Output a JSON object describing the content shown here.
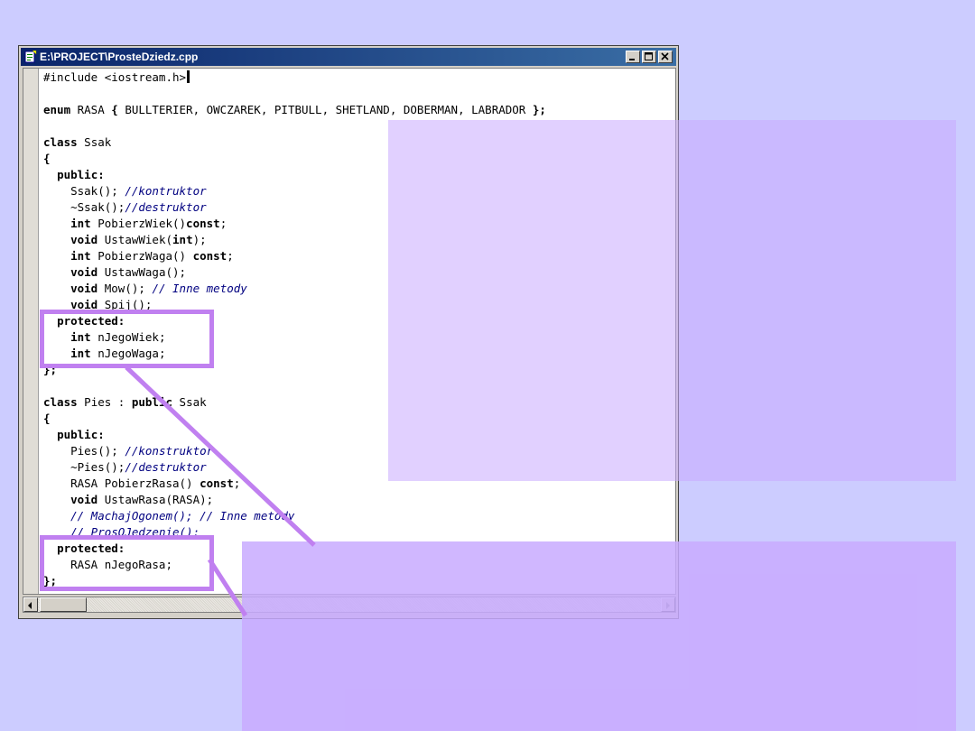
{
  "window": {
    "title": "E:\\PROJECT\\ProsteDziedz.cpp",
    "icon": "cpp-file-icon",
    "buttons": [
      "minimize-icon",
      "maximize-icon",
      "close-icon"
    ]
  },
  "code": {
    "lines": [
      [
        {
          "t": "#include <iostream.h>",
          "s": "n"
        }
      ],
      [
        {
          "t": "",
          "s": "n"
        }
      ],
      [
        {
          "t": "enum",
          "s": "kw"
        },
        {
          "t": " RASA ",
          "s": "n"
        },
        {
          "t": "{",
          "s": "kw"
        },
        {
          "t": " BULLTERIER, OWCZAREK, PITBULL, SHETLAND, DOBERMAN, LABRADOR ",
          "s": "n"
        },
        {
          "t": "};",
          "s": "kw"
        }
      ],
      [
        {
          "t": "",
          "s": "n"
        }
      ],
      [
        {
          "t": "class",
          "s": "kw"
        },
        {
          "t": " Ssak",
          "s": "n"
        }
      ],
      [
        {
          "t": "{",
          "s": "kw"
        }
      ],
      [
        {
          "t": "  ",
          "s": "n"
        },
        {
          "t": "public:",
          "s": "kw"
        }
      ],
      [
        {
          "t": "    Ssak(); ",
          "s": "n"
        },
        {
          "t": "//kontruktor",
          "s": "cm"
        }
      ],
      [
        {
          "t": "    ~Ssak();",
          "s": "n"
        },
        {
          "t": "//destruktor",
          "s": "cm"
        }
      ],
      [
        {
          "t": "    ",
          "s": "n"
        },
        {
          "t": "int",
          "s": "kw"
        },
        {
          "t": " PobierzWiek()",
          "s": "n"
        },
        {
          "t": "const",
          "s": "kw"
        },
        {
          "t": ";",
          "s": "n"
        }
      ],
      [
        {
          "t": "    ",
          "s": "n"
        },
        {
          "t": "void",
          "s": "kw"
        },
        {
          "t": " UstawWiek(",
          "s": "n"
        },
        {
          "t": "int",
          "s": "kw"
        },
        {
          "t": ");",
          "s": "n"
        }
      ],
      [
        {
          "t": "    ",
          "s": "n"
        },
        {
          "t": "int",
          "s": "kw"
        },
        {
          "t": " PobierzWaga() ",
          "s": "n"
        },
        {
          "t": "const",
          "s": "kw"
        },
        {
          "t": ";",
          "s": "n"
        }
      ],
      [
        {
          "t": "    ",
          "s": "n"
        },
        {
          "t": "void",
          "s": "kw"
        },
        {
          "t": " UstawWaga();",
          "s": "n"
        }
      ],
      [
        {
          "t": "    ",
          "s": "n"
        },
        {
          "t": "void",
          "s": "kw"
        },
        {
          "t": " Mow(); ",
          "s": "n"
        },
        {
          "t": "// Inne metody",
          "s": "cm"
        }
      ],
      [
        {
          "t": "    ",
          "s": "n"
        },
        {
          "t": "void",
          "s": "kw"
        },
        {
          "t": " Spij();",
          "s": "n"
        }
      ],
      [
        {
          "t": "  ",
          "s": "n"
        },
        {
          "t": "protected:",
          "s": "kw"
        }
      ],
      [
        {
          "t": "    ",
          "s": "n"
        },
        {
          "t": "int",
          "s": "kw"
        },
        {
          "t": " nJegoWiek;",
          "s": "n"
        }
      ],
      [
        {
          "t": "    ",
          "s": "n"
        },
        {
          "t": "int",
          "s": "kw"
        },
        {
          "t": " nJegoWaga;",
          "s": "n"
        }
      ],
      [
        {
          "t": "};",
          "s": "kw"
        }
      ],
      [
        {
          "t": "",
          "s": "n"
        }
      ],
      [
        {
          "t": "class",
          "s": "kw"
        },
        {
          "t": " Pies : ",
          "s": "n"
        },
        {
          "t": "public",
          "s": "kw"
        },
        {
          "t": " Ssak",
          "s": "n"
        }
      ],
      [
        {
          "t": "{",
          "s": "kw"
        }
      ],
      [
        {
          "t": "  ",
          "s": "n"
        },
        {
          "t": "public:",
          "s": "kw"
        }
      ],
      [
        {
          "t": "    Pies(); ",
          "s": "n"
        },
        {
          "t": "//konstruktor",
          "s": "cm"
        }
      ],
      [
        {
          "t": "    ~Pies();",
          "s": "n"
        },
        {
          "t": "//destruktor",
          "s": "cm"
        }
      ],
      [
        {
          "t": "    RASA PobierzRasa() ",
          "s": "n"
        },
        {
          "t": "const",
          "s": "kw"
        },
        {
          "t": ";",
          "s": "n"
        }
      ],
      [
        {
          "t": "    ",
          "s": "n"
        },
        {
          "t": "void",
          "s": "kw"
        },
        {
          "t": " UstawRasa(RASA);",
          "s": "n"
        }
      ],
      [
        {
          "t": "    ",
          "s": "n"
        },
        {
          "t": "// MachajOgonem(); // Inne metody",
          "s": "cm"
        }
      ],
      [
        {
          "t": "    ",
          "s": "n"
        },
        {
          "t": "// ProsOJedzenie();",
          "s": "cm"
        }
      ],
      [
        {
          "t": "  ",
          "s": "n"
        },
        {
          "t": "protected:",
          "s": "kw"
        }
      ],
      [
        {
          "t": "    RASA nJegoRasa;",
          "s": "n"
        }
      ],
      [
        {
          "t": "};",
          "s": "kw"
        }
      ]
    ]
  },
  "colors": {
    "background": "#ccccff",
    "titlebar": "#0a246a",
    "comment": "#000080",
    "highlight": "#c080f0",
    "overlay": "#c8aaff"
  }
}
